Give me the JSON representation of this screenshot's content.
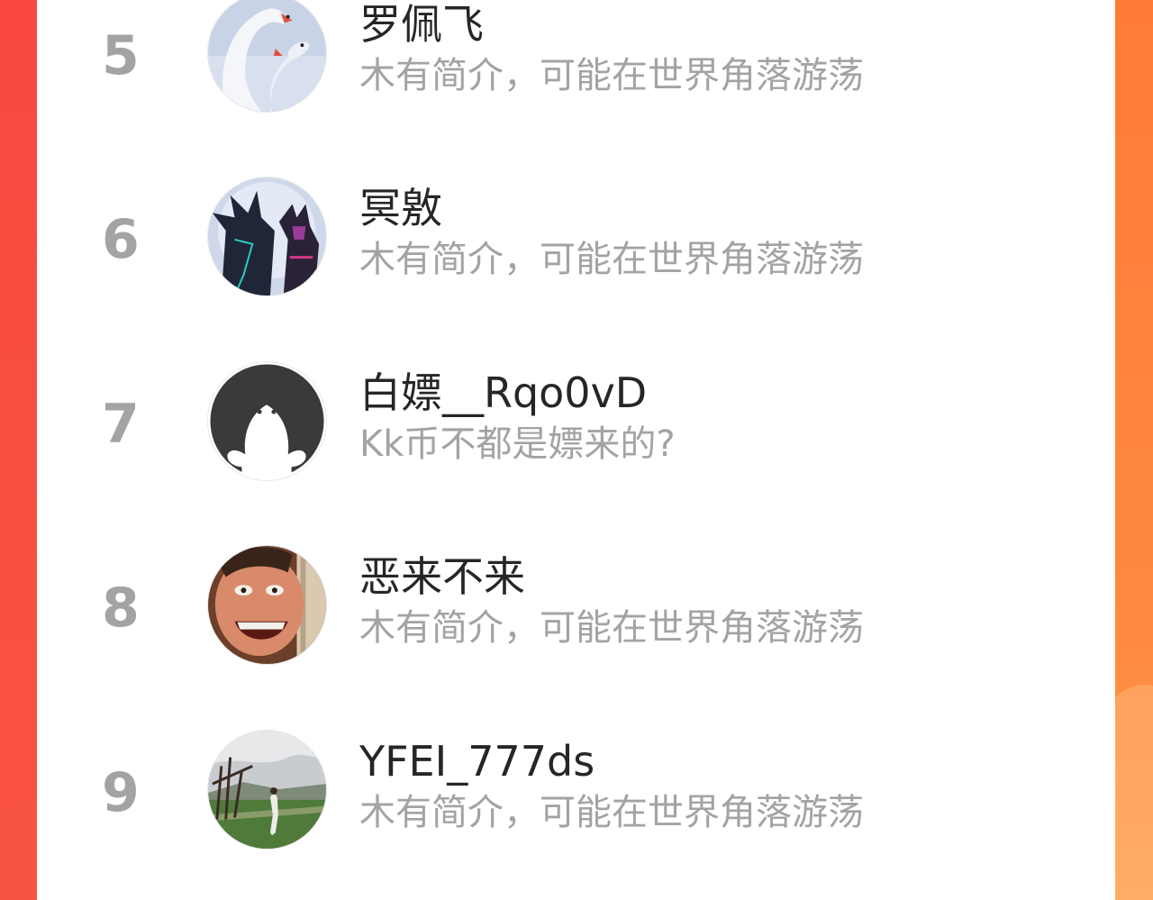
{
  "rankings": [
    {
      "rank": "5",
      "name": "罗佩飞",
      "bio": "木有简介，可能在世界角落游荡",
      "avatar_icon": "swans-avatar"
    },
    {
      "rank": "6",
      "name": "冥敫",
      "bio": "木有简介，可能在世界角落游荡",
      "avatar_icon": "dark-armored-figures-avatar"
    },
    {
      "rank": "7",
      "name": "白嫖__Rqo0vD",
      "bio": "Kk币不都是嫖来的?",
      "avatar_icon": "default-ghost-avatar"
    },
    {
      "rank": "8",
      "name": "恶来不来",
      "bio": "木有简介，可能在世界角落游荡",
      "avatar_icon": "laughing-face-avatar"
    },
    {
      "rank": "9",
      "name": "YFEI_777ds",
      "bio": "木有简介，可能在世界角落游荡",
      "avatar_icon": "landscape-person-avatar"
    }
  ],
  "colors": {
    "background_left": "#f84840",
    "background_right": "#ff8a36",
    "card": "#ffffff",
    "rank_text": "#a3a3a3",
    "name_text": "#262626",
    "bio_text": "#a3a3a3"
  }
}
